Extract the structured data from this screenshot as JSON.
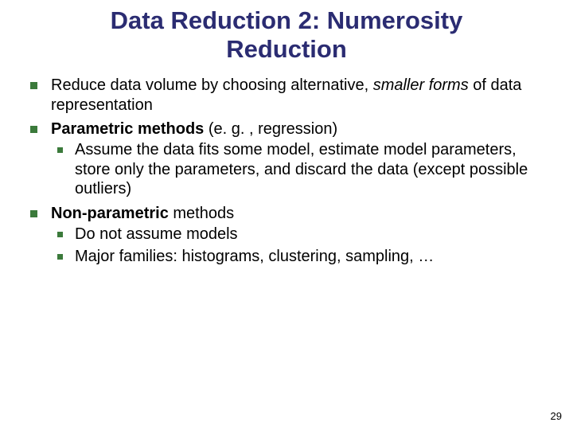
{
  "title_line1": "Data Reduction 2: Numerosity",
  "title_line2": "Reduction",
  "b1_pre": "Reduce data volume by choosing alternative, ",
  "b1_it1": "smaller",
  "b1_mid": " ",
  "b1_it2": "forms",
  "b1_post": " of data representation",
  "b2_bold": "Parametric methods",
  "b2_post": " (e. g. , regression)",
  "b2_sub1": "Assume the data fits some model, estimate model parameters, store only the parameters, and discard the data (except possible outliers)",
  "b3_bold": "Non-parametric",
  "b3_post": " methods",
  "b3_sub1": "Do not assume models",
  "b3_sub2": "Major families: histograms, clustering, sampling, …",
  "page_number": "29"
}
